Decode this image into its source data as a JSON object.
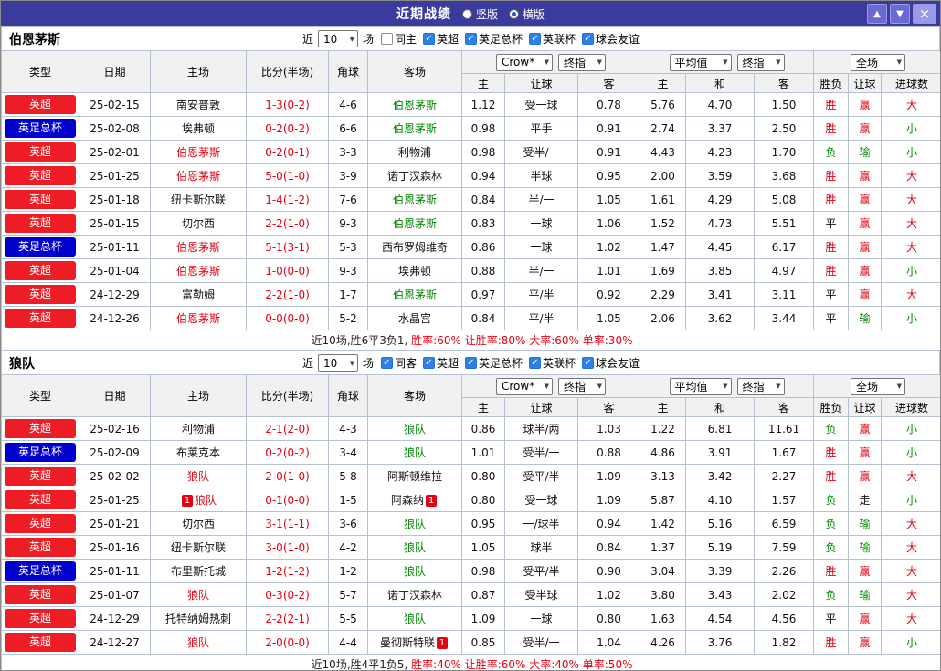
{
  "titlebar": {
    "title": "近期战绩",
    "radios": [
      {
        "label": "竖版",
        "selected": false
      },
      {
        "label": "横版",
        "selected": true
      }
    ],
    "up_icon": "▲",
    "down_icon": "▼",
    "close_icon": "×"
  },
  "filter": {
    "prefix": "近",
    "count": "10",
    "suffix": "场"
  },
  "table_header": {
    "left_cols": [
      "类型",
      "日期",
      "主场",
      "比分(半场)",
      "角球",
      "客场"
    ],
    "dropdowns": {
      "odds_source": "Crow*",
      "odds_time1": "终指",
      "avg_source": "平均值",
      "odds_time2": "终指",
      "scope": "全场"
    },
    "sub_cols": [
      "主",
      "让球",
      "客",
      "主",
      "和",
      "客",
      "胜负",
      "让球",
      "进球数"
    ]
  },
  "colors": {
    "red": "#e60012",
    "green": "#008800",
    "badge_red": "#ee1c25",
    "badge_blue": "#0000cc",
    "titlebar": "#3b3b9e"
  },
  "sections": [
    {
      "team": "伯恩茅斯",
      "same_label": "同主",
      "same_checked": false,
      "leagues": [
        {
          "label": "英超",
          "checked": true
        },
        {
          "label": "英足总杯",
          "checked": true
        },
        {
          "label": "英联杯",
          "checked": true
        },
        {
          "label": "球会友谊",
          "checked": true
        }
      ],
      "rows": [
        {
          "league": "英超",
          "badge": "red",
          "date": "25-02-15",
          "home": {
            "name": "南安普敦",
            "color": "black"
          },
          "score": "1-3(0-2)",
          "corner": "4-6",
          "away": {
            "name": "伯恩茅斯",
            "color": "green"
          },
          "odds": [
            "1.12",
            "受一球",
            "0.78",
            "5.76",
            "4.70",
            "1.50"
          ],
          "res": [
            [
              "胜",
              "red"
            ],
            [
              "赢",
              "red"
            ],
            [
              "大",
              "red"
            ]
          ]
        },
        {
          "league": "英足总杯",
          "badge": "blue",
          "date": "25-02-08",
          "home": {
            "name": "埃弗顿",
            "color": "black"
          },
          "score": "0-2(0-2)",
          "corner": "6-6",
          "away": {
            "name": "伯恩茅斯",
            "color": "green"
          },
          "odds": [
            "0.98",
            "平手",
            "0.91",
            "2.74",
            "3.37",
            "2.50"
          ],
          "res": [
            [
              "胜",
              "red"
            ],
            [
              "赢",
              "red"
            ],
            [
              "小",
              "green"
            ]
          ]
        },
        {
          "league": "英超",
          "badge": "red",
          "date": "25-02-01",
          "home": {
            "name": "伯恩茅斯",
            "color": "red"
          },
          "score": "0-2(0-1)",
          "corner": "3-3",
          "away": {
            "name": "利物浦",
            "color": "black"
          },
          "odds": [
            "0.98",
            "受半/一",
            "0.91",
            "4.43",
            "4.23",
            "1.70"
          ],
          "res": [
            [
              "负",
              "green"
            ],
            [
              "输",
              "green"
            ],
            [
              "小",
              "green"
            ]
          ]
        },
        {
          "league": "英超",
          "badge": "red",
          "date": "25-01-25",
          "home": {
            "name": "伯恩茅斯",
            "color": "red"
          },
          "score": "5-0(1-0)",
          "corner": "3-9",
          "away": {
            "name": "诺丁汉森林",
            "color": "black"
          },
          "odds": [
            "0.94",
            "半球",
            "0.95",
            "2.00",
            "3.59",
            "3.68"
          ],
          "res": [
            [
              "胜",
              "red"
            ],
            [
              "赢",
              "red"
            ],
            [
              "大",
              "red"
            ]
          ]
        },
        {
          "league": "英超",
          "badge": "red",
          "date": "25-01-18",
          "home": {
            "name": "纽卡斯尔联",
            "color": "black"
          },
          "score": "1-4(1-2)",
          "corner": "7-6",
          "away": {
            "name": "伯恩茅斯",
            "color": "green"
          },
          "odds": [
            "0.84",
            "半/一",
            "1.05",
            "1.61",
            "4.29",
            "5.08"
          ],
          "res": [
            [
              "胜",
              "red"
            ],
            [
              "赢",
              "red"
            ],
            [
              "大",
              "red"
            ]
          ]
        },
        {
          "league": "英超",
          "badge": "red",
          "date": "25-01-15",
          "home": {
            "name": "切尔西",
            "color": "black"
          },
          "score": "2-2(1-0)",
          "corner": "9-3",
          "away": {
            "name": "伯恩茅斯",
            "color": "green"
          },
          "odds": [
            "0.83",
            "一球",
            "1.06",
            "1.52",
            "4.73",
            "5.51"
          ],
          "res": [
            [
              "平",
              "black"
            ],
            [
              "赢",
              "red"
            ],
            [
              "大",
              "red"
            ]
          ]
        },
        {
          "league": "英足总杯",
          "badge": "blue",
          "date": "25-01-11",
          "home": {
            "name": "伯恩茅斯",
            "color": "red"
          },
          "score": "5-1(3-1)",
          "corner": "5-3",
          "away": {
            "name": "西布罗姆维奇",
            "color": "black"
          },
          "odds": [
            "0.86",
            "一球",
            "1.02",
            "1.47",
            "4.45",
            "6.17"
          ],
          "res": [
            [
              "胜",
              "red"
            ],
            [
              "赢",
              "red"
            ],
            [
              "大",
              "red"
            ]
          ]
        },
        {
          "league": "英超",
          "badge": "red",
          "date": "25-01-04",
          "home": {
            "name": "伯恩茅斯",
            "color": "red"
          },
          "score": "1-0(0-0)",
          "corner": "9-3",
          "away": {
            "name": "埃弗顿",
            "color": "black"
          },
          "odds": [
            "0.88",
            "半/一",
            "1.01",
            "1.69",
            "3.85",
            "4.97"
          ],
          "res": [
            [
              "胜",
              "red"
            ],
            [
              "赢",
              "red"
            ],
            [
              "小",
              "green"
            ]
          ]
        },
        {
          "league": "英超",
          "badge": "red",
          "date": "24-12-29",
          "home": {
            "name": "富勒姆",
            "color": "black"
          },
          "score": "2-2(1-0)",
          "corner": "1-7",
          "away": {
            "name": "伯恩茅斯",
            "color": "green"
          },
          "odds": [
            "0.97",
            "平/半",
            "0.92",
            "2.29",
            "3.41",
            "3.11"
          ],
          "res": [
            [
              "平",
              "black"
            ],
            [
              "赢",
              "red"
            ],
            [
              "大",
              "red"
            ]
          ]
        },
        {
          "league": "英超",
          "badge": "red",
          "date": "24-12-26",
          "home": {
            "name": "伯恩茅斯",
            "color": "red"
          },
          "score": "0-0(0-0)",
          "corner": "5-2",
          "away": {
            "name": "水晶宫",
            "color": "black"
          },
          "odds": [
            "0.84",
            "平/半",
            "1.05",
            "2.06",
            "3.62",
            "3.44"
          ],
          "res": [
            [
              "平",
              "black"
            ],
            [
              "输",
              "green"
            ],
            [
              "小",
              "green"
            ]
          ]
        }
      ],
      "summary": {
        "record": "近10场,胜6平3负1,",
        "rates": "胜率:60% 让胜率:80% 大率:60% 单率:30%"
      }
    },
    {
      "team": "狼队",
      "same_label": "同客",
      "same_checked": true,
      "leagues": [
        {
          "label": "英超",
          "checked": true
        },
        {
          "label": "英足总杯",
          "checked": true
        },
        {
          "label": "英联杯",
          "checked": true
        },
        {
          "label": "球会友谊",
          "checked": true
        }
      ],
      "rows": [
        {
          "league": "英超",
          "badge": "red",
          "date": "25-02-16",
          "home": {
            "name": "利物浦",
            "color": "black"
          },
          "score": "2-1(2-0)",
          "corner": "4-3",
          "away": {
            "name": "狼队",
            "color": "green"
          },
          "odds": [
            "0.86",
            "球半/两",
            "1.03",
            "1.22",
            "6.81",
            "11.61"
          ],
          "res": [
            [
              "负",
              "green"
            ],
            [
              "赢",
              "red"
            ],
            [
              "小",
              "green"
            ]
          ]
        },
        {
          "league": "英足总杯",
          "badge": "blue",
          "date": "25-02-09",
          "home": {
            "name": "布莱克本",
            "color": "black"
          },
          "score": "0-2(0-2)",
          "corner": "3-4",
          "away": {
            "name": "狼队",
            "color": "green"
          },
          "odds": [
            "1.01",
            "受半/一",
            "0.88",
            "4.86",
            "3.91",
            "1.67"
          ],
          "res": [
            [
              "胜",
              "red"
            ],
            [
              "赢",
              "red"
            ],
            [
              "小",
              "green"
            ]
          ]
        },
        {
          "league": "英超",
          "badge": "red",
          "date": "25-02-02",
          "home": {
            "name": "狼队",
            "color": "red"
          },
          "score": "2-0(1-0)",
          "corner": "5-8",
          "away": {
            "name": "阿斯顿维拉",
            "color": "black"
          },
          "odds": [
            "0.80",
            "受平/半",
            "1.09",
            "3.13",
            "3.42",
            "2.27"
          ],
          "res": [
            [
              "胜",
              "red"
            ],
            [
              "赢",
              "red"
            ],
            [
              "大",
              "red"
            ]
          ]
        },
        {
          "league": "英超",
          "badge": "red",
          "date": "25-01-25",
          "home": {
            "name": "狼队",
            "color": "red",
            "card": "1"
          },
          "score": "0-1(0-0)",
          "corner": "1-5",
          "away": {
            "name": "阿森纳",
            "color": "black",
            "card": "1"
          },
          "odds": [
            "0.80",
            "受一球",
            "1.09",
            "5.87",
            "4.10",
            "1.57"
          ],
          "res": [
            [
              "负",
              "green"
            ],
            [
              "走",
              "black"
            ],
            [
              "小",
              "green"
            ]
          ]
        },
        {
          "league": "英超",
          "badge": "red",
          "date": "25-01-21",
          "home": {
            "name": "切尔西",
            "color": "black"
          },
          "score": "3-1(1-1)",
          "corner": "3-6",
          "away": {
            "name": "狼队",
            "color": "green"
          },
          "odds": [
            "0.95",
            "一/球半",
            "0.94",
            "1.42",
            "5.16",
            "6.59"
          ],
          "res": [
            [
              "负",
              "green"
            ],
            [
              "输",
              "green"
            ],
            [
              "大",
              "red"
            ]
          ]
        },
        {
          "league": "英超",
          "badge": "red",
          "date": "25-01-16",
          "home": {
            "name": "纽卡斯尔联",
            "color": "black"
          },
          "score": "3-0(1-0)",
          "corner": "4-2",
          "away": {
            "name": "狼队",
            "color": "green"
          },
          "odds": [
            "1.05",
            "球半",
            "0.84",
            "1.37",
            "5.19",
            "7.59"
          ],
          "res": [
            [
              "负",
              "green"
            ],
            [
              "输",
              "green"
            ],
            [
              "大",
              "red"
            ]
          ]
        },
        {
          "league": "英足总杯",
          "badge": "blue",
          "date": "25-01-11",
          "home": {
            "name": "布里斯托城",
            "color": "black"
          },
          "score": "1-2(1-2)",
          "corner": "1-2",
          "away": {
            "name": "狼队",
            "color": "green"
          },
          "odds": [
            "0.98",
            "受平/半",
            "0.90",
            "3.04",
            "3.39",
            "2.26"
          ],
          "res": [
            [
              "胜",
              "red"
            ],
            [
              "赢",
              "red"
            ],
            [
              "大",
              "red"
            ]
          ]
        },
        {
          "league": "英超",
          "badge": "red",
          "date": "25-01-07",
          "home": {
            "name": "狼队",
            "color": "red"
          },
          "score": "0-3(0-2)",
          "corner": "5-7",
          "away": {
            "name": "诺丁汉森林",
            "color": "black"
          },
          "odds": [
            "0.87",
            "受半球",
            "1.02",
            "3.80",
            "3.43",
            "2.02"
          ],
          "res": [
            [
              "负",
              "green"
            ],
            [
              "输",
              "green"
            ],
            [
              "大",
              "red"
            ]
          ]
        },
        {
          "league": "英超",
          "badge": "red",
          "date": "24-12-29",
          "home": {
            "name": "托特纳姆热刺",
            "color": "black"
          },
          "score": "2-2(2-1)",
          "corner": "5-5",
          "away": {
            "name": "狼队",
            "color": "green"
          },
          "odds": [
            "1.09",
            "一球",
            "0.80",
            "1.63",
            "4.54",
            "4.56"
          ],
          "res": [
            [
              "平",
              "black"
            ],
            [
              "赢",
              "red"
            ],
            [
              "大",
              "red"
            ]
          ]
        },
        {
          "league": "英超",
          "badge": "red",
          "date": "24-12-27",
          "home": {
            "name": "狼队",
            "color": "red"
          },
          "score": "2-0(0-0)",
          "corner": "4-4",
          "away": {
            "name": "曼彻斯特联",
            "color": "black",
            "card": "1"
          },
          "odds": [
            "0.85",
            "受半/一",
            "1.04",
            "4.26",
            "3.76",
            "1.82"
          ],
          "res": [
            [
              "胜",
              "red"
            ],
            [
              "赢",
              "red"
            ],
            [
              "小",
              "green"
            ]
          ]
        }
      ],
      "summary": {
        "record": "近10场,胜4平1负5,",
        "rates": "胜率:40% 让胜率:60% 大率:40% 单率:50%"
      }
    }
  ]
}
